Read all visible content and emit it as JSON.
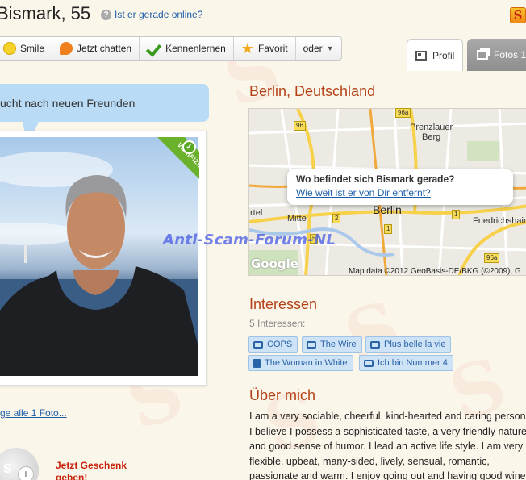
{
  "profile": {
    "name_age": "Bismark, 55",
    "online_link": "Ist er gerade online?",
    "question_mark": "?",
    "logo_letter": "S"
  },
  "actions": {
    "smile": "Smile",
    "chat": "Jetzt chatten",
    "meet": "Kennenlernen",
    "favorite": "Favorit",
    "more": "oder"
  },
  "tabs": {
    "profile": "Profil",
    "photos": "Fotos 1"
  },
  "bubble": {
    "text": "ucht nach neuen Freunden"
  },
  "photo": {
    "badge": "VERIFIZIERT",
    "all_photos": "ge alle 1 Foto..."
  },
  "gift": {
    "avatar_text": "S",
    "plus": "+",
    "link": "Jetzt Geschenk geben!"
  },
  "location": {
    "title": "Berlin, Deutschland",
    "popup_title": "Wo befindet sich Bismark gerade?",
    "popup_link": "Wie weit ist er von Dir entfernt?",
    "map_labels": {
      "prenzlauer": "Prenzlauer",
      "berg": "Berg",
      "mitte": "Mitte",
      "berlin": "Berlin",
      "friedrichshain": "Friedrichshain",
      "rtel": "rtel"
    },
    "road_badges": [
      "96a",
      "96",
      "2",
      "1",
      "1",
      "96a",
      "5"
    ],
    "google": "Google",
    "map_copyright": "Map data ©2012 GeoBasis-DE/BKG (©2009), G"
  },
  "watermark": "Anti-Scam-Forum-NL",
  "interests": {
    "title": "Interessen",
    "count": "5 Interessen:",
    "tags": [
      "COPS",
      "The Wire",
      "Plus belle la vie",
      "The Woman in White",
      "Ich bin Nummer 4"
    ]
  },
  "about": {
    "title": "Über mich",
    "text": "I am a very sociable, cheerful, kind-hearted and caring person. I believe I possess a sophisticated taste, a very friendly nature and good sense of humor. I lead an active life style. I am very flexible, upbeat, many-sided, lively, sensual, romantic, passionate and warm. I enjoy going out and having good wine with a nice person and"
  },
  "colors": {
    "accent": "#b5431a",
    "link": "#1d5da8",
    "bubble": "#b9dbf6",
    "verified": "#6bb22c"
  }
}
